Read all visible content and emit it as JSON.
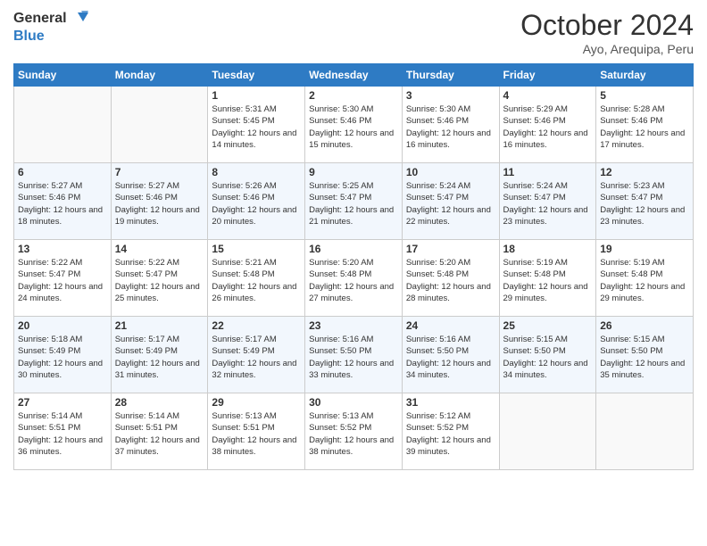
{
  "header": {
    "logo_line1": "General",
    "logo_line2": "Blue",
    "month": "October 2024",
    "location": "Ayo, Arequipa, Peru"
  },
  "weekdays": [
    "Sunday",
    "Monday",
    "Tuesday",
    "Wednesday",
    "Thursday",
    "Friday",
    "Saturday"
  ],
  "weeks": [
    [
      {
        "day": "",
        "info": ""
      },
      {
        "day": "",
        "info": ""
      },
      {
        "day": "1",
        "info": "Sunrise: 5:31 AM\nSunset: 5:45 PM\nDaylight: 12 hours and 14 minutes."
      },
      {
        "day": "2",
        "info": "Sunrise: 5:30 AM\nSunset: 5:46 PM\nDaylight: 12 hours and 15 minutes."
      },
      {
        "day": "3",
        "info": "Sunrise: 5:30 AM\nSunset: 5:46 PM\nDaylight: 12 hours and 16 minutes."
      },
      {
        "day": "4",
        "info": "Sunrise: 5:29 AM\nSunset: 5:46 PM\nDaylight: 12 hours and 16 minutes."
      },
      {
        "day": "5",
        "info": "Sunrise: 5:28 AM\nSunset: 5:46 PM\nDaylight: 12 hours and 17 minutes."
      }
    ],
    [
      {
        "day": "6",
        "info": "Sunrise: 5:27 AM\nSunset: 5:46 PM\nDaylight: 12 hours and 18 minutes."
      },
      {
        "day": "7",
        "info": "Sunrise: 5:27 AM\nSunset: 5:46 PM\nDaylight: 12 hours and 19 minutes."
      },
      {
        "day": "8",
        "info": "Sunrise: 5:26 AM\nSunset: 5:46 PM\nDaylight: 12 hours and 20 minutes."
      },
      {
        "day": "9",
        "info": "Sunrise: 5:25 AM\nSunset: 5:47 PM\nDaylight: 12 hours and 21 minutes."
      },
      {
        "day": "10",
        "info": "Sunrise: 5:24 AM\nSunset: 5:47 PM\nDaylight: 12 hours and 22 minutes."
      },
      {
        "day": "11",
        "info": "Sunrise: 5:24 AM\nSunset: 5:47 PM\nDaylight: 12 hours and 23 minutes."
      },
      {
        "day": "12",
        "info": "Sunrise: 5:23 AM\nSunset: 5:47 PM\nDaylight: 12 hours and 23 minutes."
      }
    ],
    [
      {
        "day": "13",
        "info": "Sunrise: 5:22 AM\nSunset: 5:47 PM\nDaylight: 12 hours and 24 minutes."
      },
      {
        "day": "14",
        "info": "Sunrise: 5:22 AM\nSunset: 5:47 PM\nDaylight: 12 hours and 25 minutes."
      },
      {
        "day": "15",
        "info": "Sunrise: 5:21 AM\nSunset: 5:48 PM\nDaylight: 12 hours and 26 minutes."
      },
      {
        "day": "16",
        "info": "Sunrise: 5:20 AM\nSunset: 5:48 PM\nDaylight: 12 hours and 27 minutes."
      },
      {
        "day": "17",
        "info": "Sunrise: 5:20 AM\nSunset: 5:48 PM\nDaylight: 12 hours and 28 minutes."
      },
      {
        "day": "18",
        "info": "Sunrise: 5:19 AM\nSunset: 5:48 PM\nDaylight: 12 hours and 29 minutes."
      },
      {
        "day": "19",
        "info": "Sunrise: 5:19 AM\nSunset: 5:48 PM\nDaylight: 12 hours and 29 minutes."
      }
    ],
    [
      {
        "day": "20",
        "info": "Sunrise: 5:18 AM\nSunset: 5:49 PM\nDaylight: 12 hours and 30 minutes."
      },
      {
        "day": "21",
        "info": "Sunrise: 5:17 AM\nSunset: 5:49 PM\nDaylight: 12 hours and 31 minutes."
      },
      {
        "day": "22",
        "info": "Sunrise: 5:17 AM\nSunset: 5:49 PM\nDaylight: 12 hours and 32 minutes."
      },
      {
        "day": "23",
        "info": "Sunrise: 5:16 AM\nSunset: 5:50 PM\nDaylight: 12 hours and 33 minutes."
      },
      {
        "day": "24",
        "info": "Sunrise: 5:16 AM\nSunset: 5:50 PM\nDaylight: 12 hours and 34 minutes."
      },
      {
        "day": "25",
        "info": "Sunrise: 5:15 AM\nSunset: 5:50 PM\nDaylight: 12 hours and 34 minutes."
      },
      {
        "day": "26",
        "info": "Sunrise: 5:15 AM\nSunset: 5:50 PM\nDaylight: 12 hours and 35 minutes."
      }
    ],
    [
      {
        "day": "27",
        "info": "Sunrise: 5:14 AM\nSunset: 5:51 PM\nDaylight: 12 hours and 36 minutes."
      },
      {
        "day": "28",
        "info": "Sunrise: 5:14 AM\nSunset: 5:51 PM\nDaylight: 12 hours and 37 minutes."
      },
      {
        "day": "29",
        "info": "Sunrise: 5:13 AM\nSunset: 5:51 PM\nDaylight: 12 hours and 38 minutes."
      },
      {
        "day": "30",
        "info": "Sunrise: 5:13 AM\nSunset: 5:52 PM\nDaylight: 12 hours and 38 minutes."
      },
      {
        "day": "31",
        "info": "Sunrise: 5:12 AM\nSunset: 5:52 PM\nDaylight: 12 hours and 39 minutes."
      },
      {
        "day": "",
        "info": ""
      },
      {
        "day": "",
        "info": ""
      }
    ]
  ]
}
